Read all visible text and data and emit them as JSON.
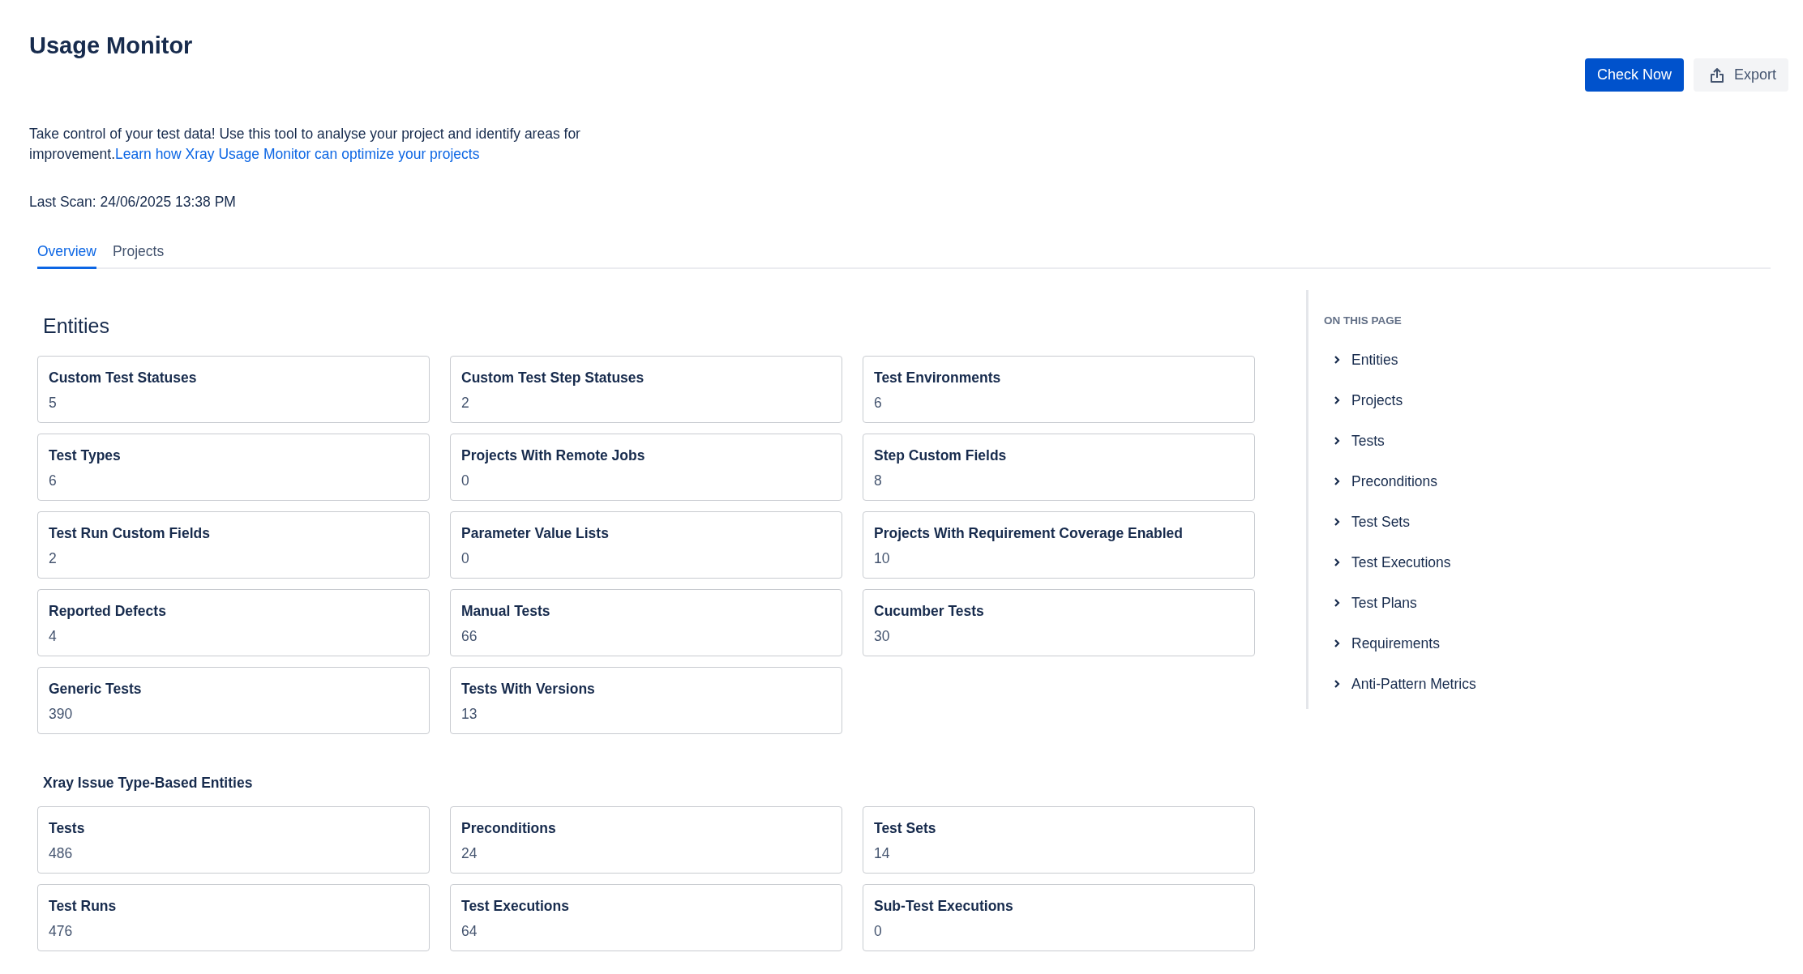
{
  "page_title": "Usage Monitor",
  "actions": [
    {
      "kind": "primary",
      "label": "Check Now"
    },
    {
      "kind": "export",
      "label": "Export"
    }
  ],
  "description": {
    "text": "Take control of your test data! Use this tool to analyse your project and identify areas for improvement.",
    "link": "Learn how Xray Usage Monitor can optimize your projects"
  },
  "last_scan": "Last Scan: 24/06/2025 13:38 PM",
  "tabs": [
    {
      "label": "Overview",
      "selected": true
    },
    {
      "label": "Projects",
      "selected": false
    }
  ],
  "sections": [
    {
      "title": "Entities",
      "kind": "major",
      "cards": [
        {
          "label": "Custom Test Statuses",
          "value": "5"
        },
        {
          "label": "Custom Test Step Statuses",
          "value": "2"
        },
        {
          "label": "Test Environments",
          "value": "6"
        },
        {
          "label": "Test Types",
          "value": "6"
        },
        {
          "label": "Projects With Remote Jobs",
          "value": "0"
        },
        {
          "label": "Step Custom Fields",
          "value": "8"
        },
        {
          "label": "Test Run Custom Fields",
          "value": "2"
        },
        {
          "label": "Parameter Value Lists",
          "value": "0"
        },
        {
          "label": "Projects With Requirement Coverage Enabled",
          "value": "10"
        },
        {
          "label": "Reported Defects",
          "value": "4"
        },
        {
          "label": "Manual Tests",
          "value": "66"
        },
        {
          "label": "Cucumber Tests",
          "value": "30"
        },
        {
          "label": "Generic Tests",
          "value": "390"
        },
        {
          "label": "Tests With Versions",
          "value": "13"
        }
      ]
    },
    {
      "title": "Xray Issue Type-Based Entities",
      "kind": "minor",
      "cards": [
        {
          "label": "Tests",
          "value": "486"
        },
        {
          "label": "Preconditions",
          "value": "24"
        },
        {
          "label": "Test Sets",
          "value": "14"
        },
        {
          "label": "Test Runs",
          "value": "476"
        },
        {
          "label": "Test Executions",
          "value": "64"
        },
        {
          "label": "Sub-Test Executions",
          "value": "0"
        }
      ]
    }
  ],
  "on_this_page": {
    "heading": "ON THIS PAGE",
    "items": [
      "Entities",
      "Projects",
      "Tests",
      "Preconditions",
      "Test Sets",
      "Test Executions",
      "Test Plans",
      "Requirements",
      "Anti-Pattern Metrics"
    ]
  }
}
